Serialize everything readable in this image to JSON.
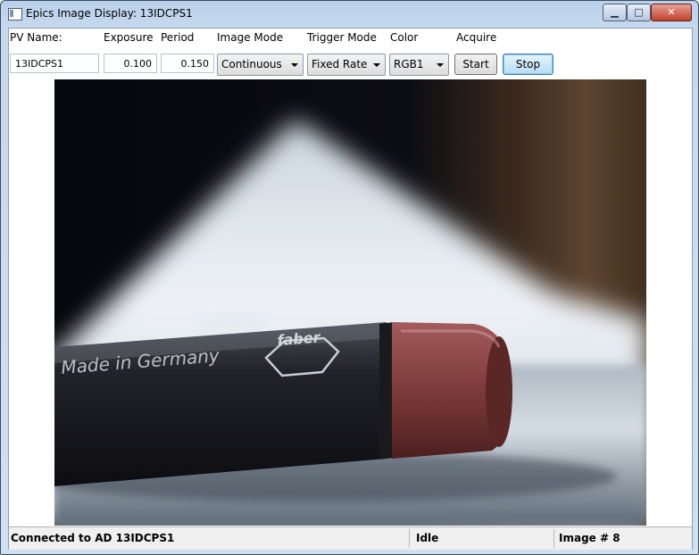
{
  "window": {
    "title": "Epics Image Display: 13IDCPS1",
    "controls": {
      "minimize": "▁",
      "maximize": "□",
      "close": "✕"
    }
  },
  "labels": {
    "pv_name": "PV Name:",
    "exposure": "Exposure",
    "period": "Period",
    "image_mode": "Image Mode",
    "trigger_mode": "Trigger Mode",
    "color": "Color",
    "acquire": "Acquire"
  },
  "controls": {
    "pv_name_value": "13IDCPS1",
    "exposure_value": "0.100",
    "period_value": "0.150",
    "image_mode_selected": "Continuous",
    "trigger_mode_selected": "Fixed Rate",
    "color_selected": "RGB1",
    "start_label": "Start",
    "stop_label": "Stop"
  },
  "image": {
    "pencil_text": "Made in Germany",
    "pencil_logo": "faber"
  },
  "status": {
    "connection": "Connected to AD 13IDCPS1",
    "state": "Idle",
    "image_count": "Image # 8"
  }
}
